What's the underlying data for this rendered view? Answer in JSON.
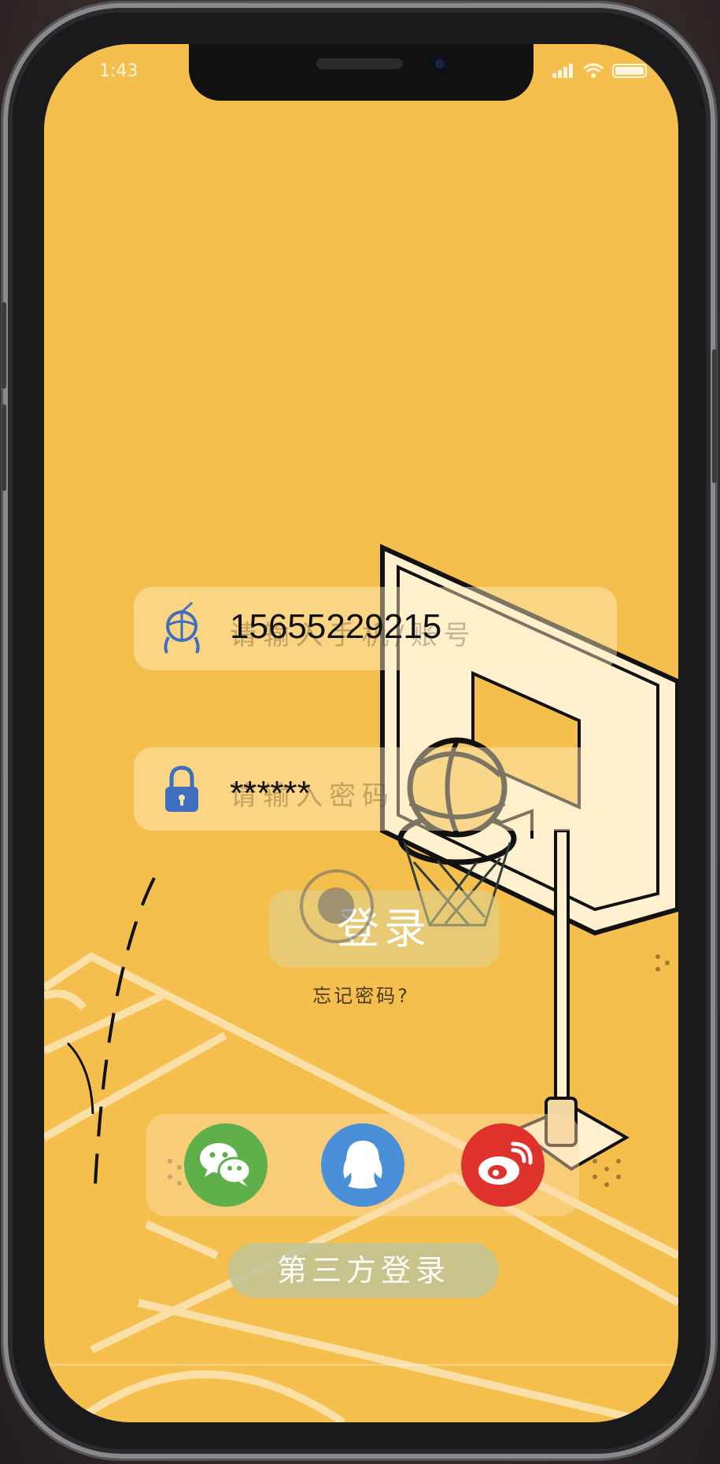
{
  "status_bar": {
    "time": "1:43"
  },
  "login": {
    "account_value": "15655229215",
    "account_placeholder": "请输入手机/账号",
    "password_value": "******",
    "password_placeholder": "请输入密码",
    "login_button": "登录",
    "forgot_password": "忘记密码?"
  },
  "third_party": {
    "label": "第三方登录",
    "providers": [
      {
        "name": "wechat",
        "icon": "wechat-icon",
        "color": "#5fb04a"
      },
      {
        "name": "qq",
        "icon": "qq-icon",
        "color": "#4a90d9"
      },
      {
        "name": "weibo",
        "icon": "weibo-icon",
        "color": "#e0322c"
      }
    ]
  },
  "colors": {
    "background": "#f5bf4d",
    "accent": "#3e6fbf"
  }
}
